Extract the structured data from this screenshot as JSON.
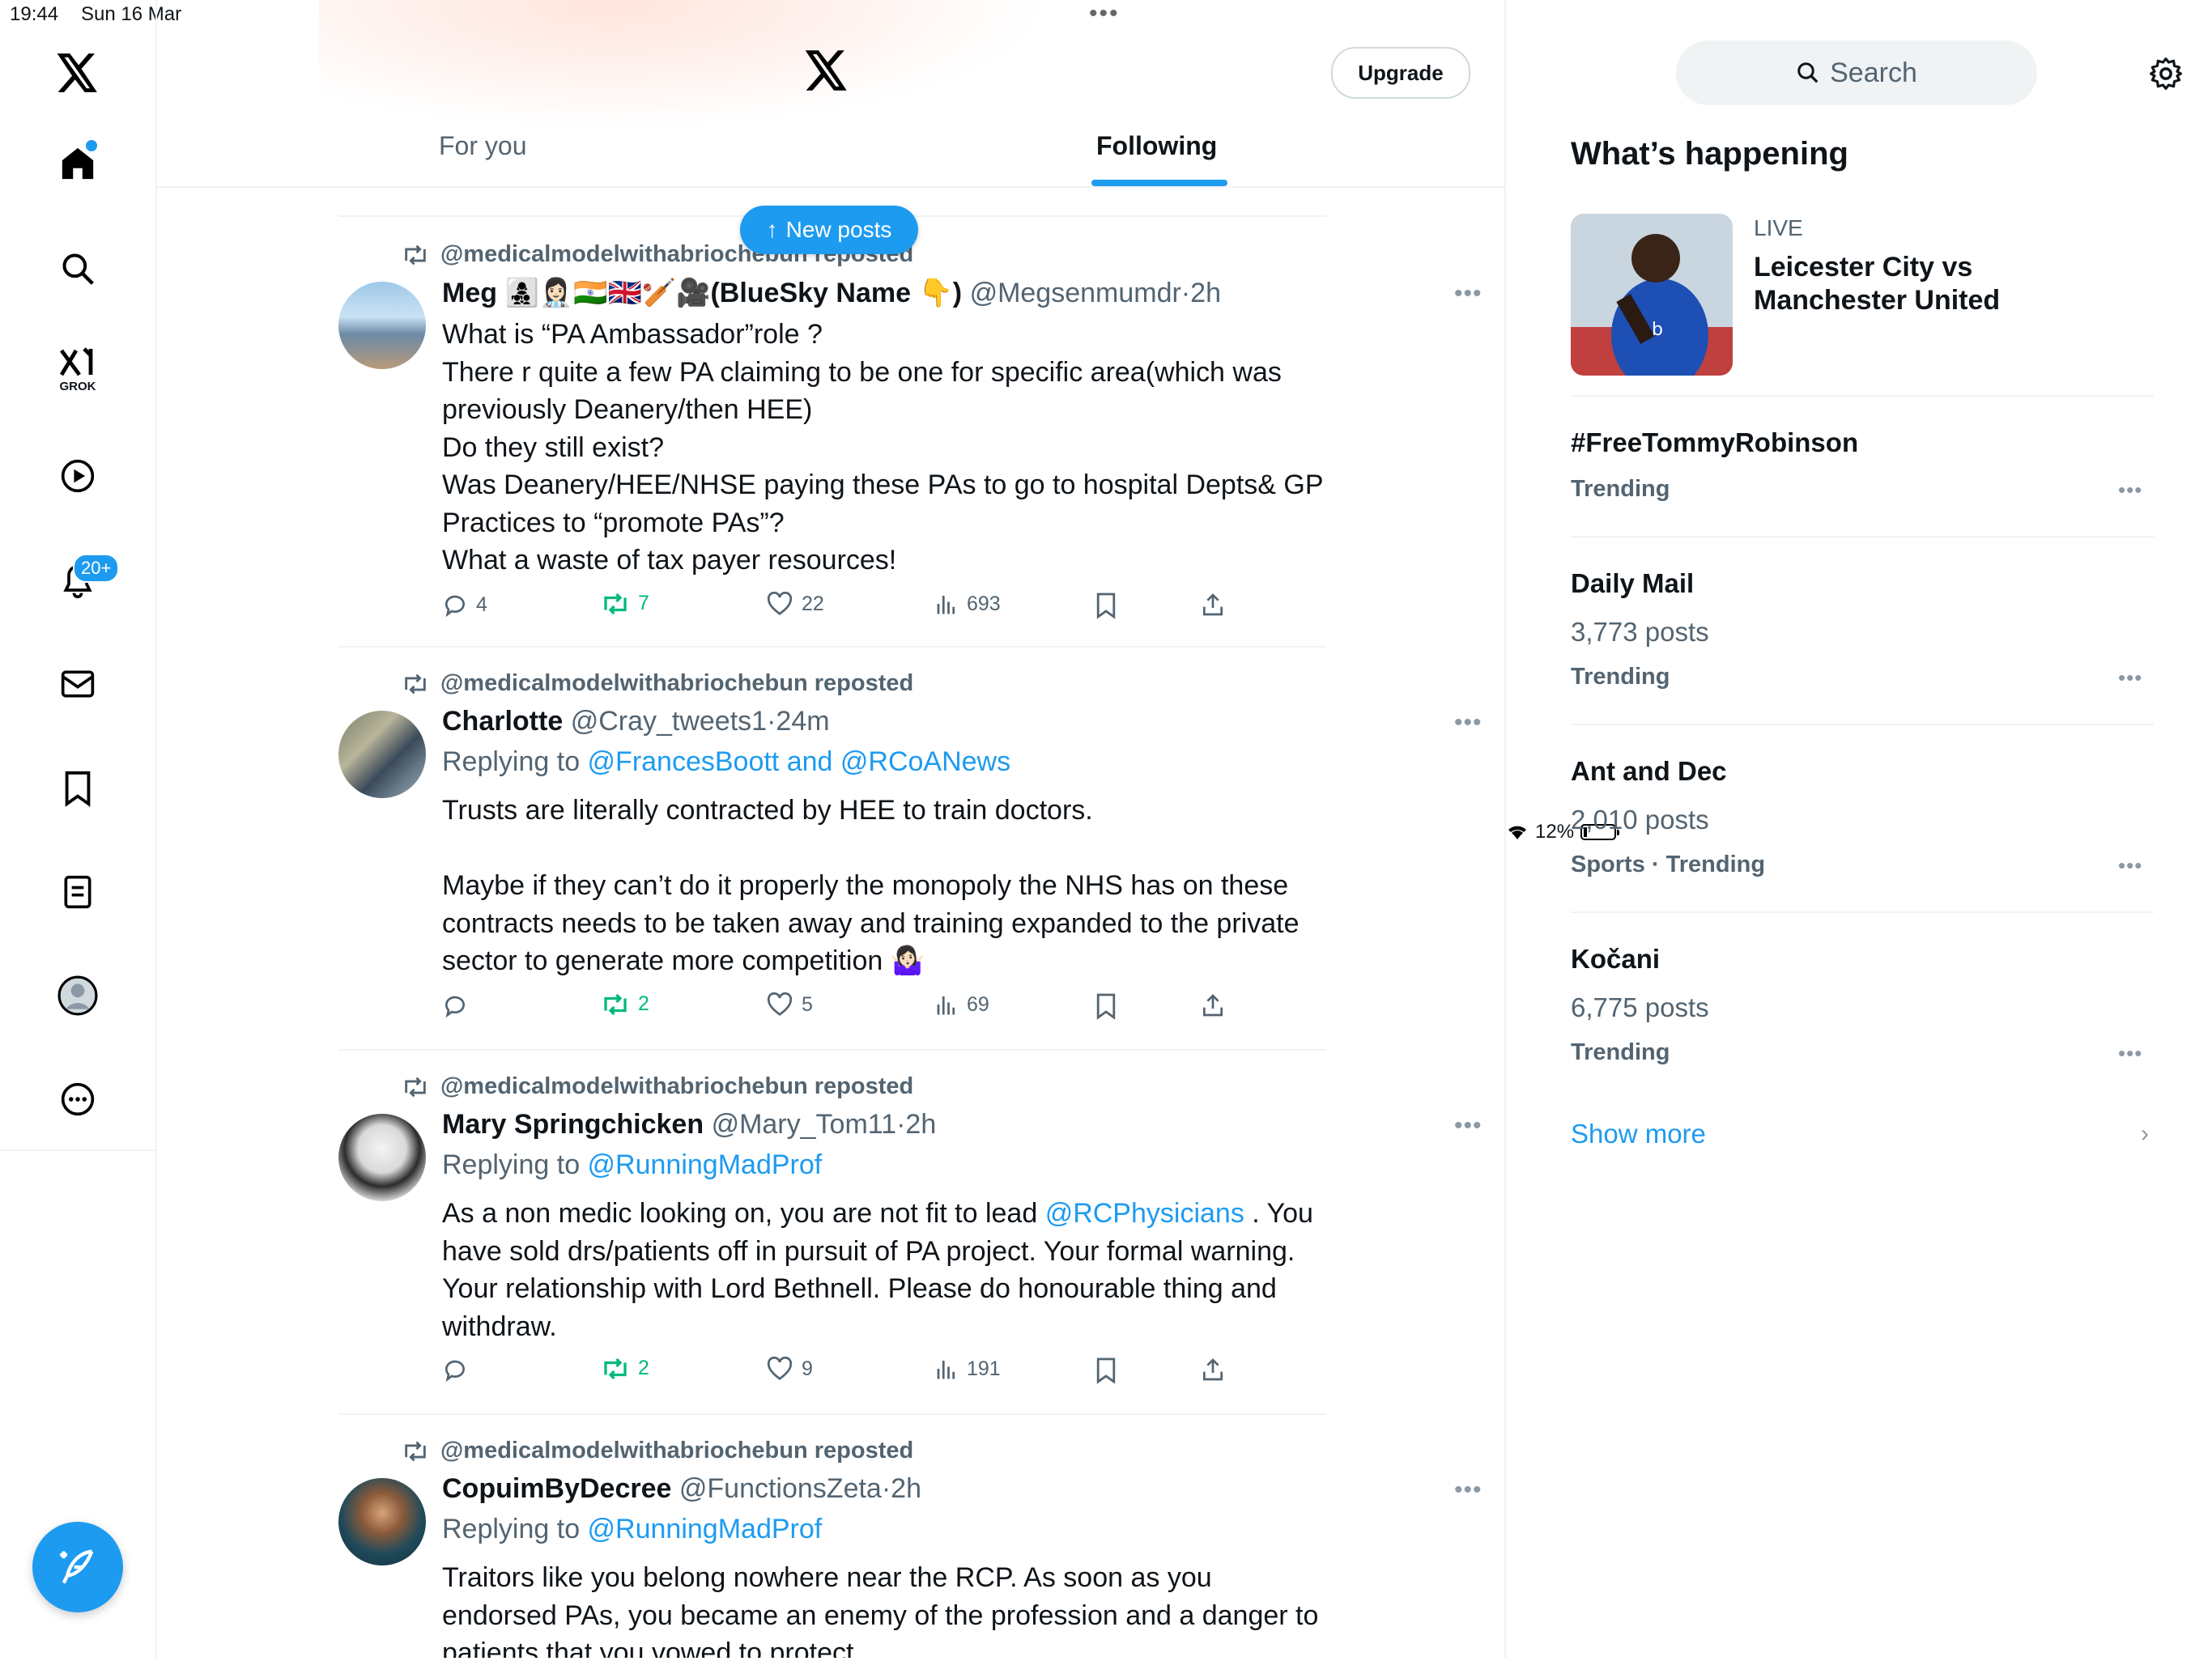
{
  "status_bar": {
    "time": "19:44",
    "date": "Sun 16 Mar",
    "battery": "12%"
  },
  "nav": {
    "notification_badge": "20+",
    "grok_label": "GROK"
  },
  "header": {
    "upgrade_label": "Upgrade"
  },
  "tabs": [
    {
      "label": "For you"
    },
    {
      "label": "Following"
    }
  ],
  "new_posts_label": "New posts",
  "posts": [
    {
      "repost_by": "@medicalmodelwithabriochebun reposted",
      "name": "Meg 👩‍👧‍👦👩🏻‍⚕️🇮🇳🇬🇧🏏🎥(BlueSky Name 👇)",
      "handle": "@Megsenmumdr",
      "time": "2h",
      "replying_prefix": "",
      "replying_to": "",
      "lines": [
        "What is “PA Ambassador”role ?",
        "There r quite a few PA claiming to be one for specific area(which was",
        "previously Deanery/then HEE)",
        "Do they still exist?",
        "Was Deanery/HEE/NHSE paying these PAs to go to hospital Depts& GP",
        "Practices to “promote PAs”?",
        "What a waste of tax payer resources!"
      ],
      "replies": "4",
      "reposts": "7",
      "likes": "22",
      "views": "693"
    },
    {
      "repost_by": "@medicalmodelwithabriochebun reposted",
      "name": "Charlotte",
      "handle": "@Cray_tweets1",
      "time": "24m",
      "replying_prefix": "Replying to ",
      "replying_to": "@FrancesBoott and @RCoANews",
      "lines": [
        "Trusts are literally contracted by HEE to train doctors.",
        "",
        "Maybe if they can’t do it properly the monopoly the NHS has on these",
        "contracts needs to be taken away and training expanded to the private",
        "sector to generate more competition 🤷🏻‍♀️"
      ],
      "replies": "",
      "reposts": "2",
      "likes": "5",
      "views": "69"
    },
    {
      "repost_by": "@medicalmodelwithabriochebun reposted",
      "name": "Mary Springchicken",
      "handle": "@Mary_Tom11",
      "time": "2h",
      "replying_prefix": "Replying to ",
      "replying_to": "@RunningMadProf",
      "line1_pre": "As a non medic looking on, you are not fit to lead ",
      "line1_link": "@RCPhysicians",
      "line1_post": " . You",
      "lines": [
        "have sold drs/patients off in pursuit of PA project. Your formal warning.",
        "Your relationship with Lord Bethnell. Please do honourable thing and",
        "withdraw."
      ],
      "replies": "",
      "reposts": "2",
      "likes": "9",
      "views": "191"
    },
    {
      "repost_by": "@medicalmodelwithabriochebun reposted",
      "name": "CopuimByDecree",
      "handle": "@FunctionsZeta",
      "time": "2h",
      "replying_prefix": "Replying to ",
      "replying_to": "@RunningMadProf",
      "lines": [
        "Traitors like you belong nowhere near the RCP. As soon as you",
        "endorsed PAs, you became an enemy of the profession and a danger to",
        "patients that you vowed to protect"
      ]
    }
  ],
  "sidebar": {
    "search_placeholder": "Search",
    "title": "What’s happening",
    "live_label": "LIVE",
    "live_title": "Leicester City vs Manchester United",
    "trends": [
      {
        "title": "#FreeTommyRobinson",
        "count": "",
        "meta": "Trending"
      },
      {
        "title": "Daily Mail",
        "count": "3,773 posts",
        "meta": "Trending"
      },
      {
        "title": "Ant and Dec",
        "count": "2,010 posts",
        "meta": "Sports · Trending"
      },
      {
        "title": "Kočani",
        "count": "6,775 posts",
        "meta": "Trending"
      }
    ],
    "show_more": "Show more"
  },
  "icons": {
    "nav": [
      "x-logo-icon",
      "home-icon",
      "search-icon",
      "grok-icon",
      "video-icon",
      "notifications-icon",
      "messages-icon",
      "bookmarks-icon",
      "lists-icon",
      "profile-icon",
      "more-icon"
    ],
    "actions": [
      "reply-icon",
      "repost-icon",
      "like-icon",
      "views-icon",
      "bookmark-icon",
      "share-icon"
    ]
  },
  "colors": {
    "accent": "#1d9bf0",
    "repost_green": "#00ba7c",
    "muted": "#536471"
  }
}
